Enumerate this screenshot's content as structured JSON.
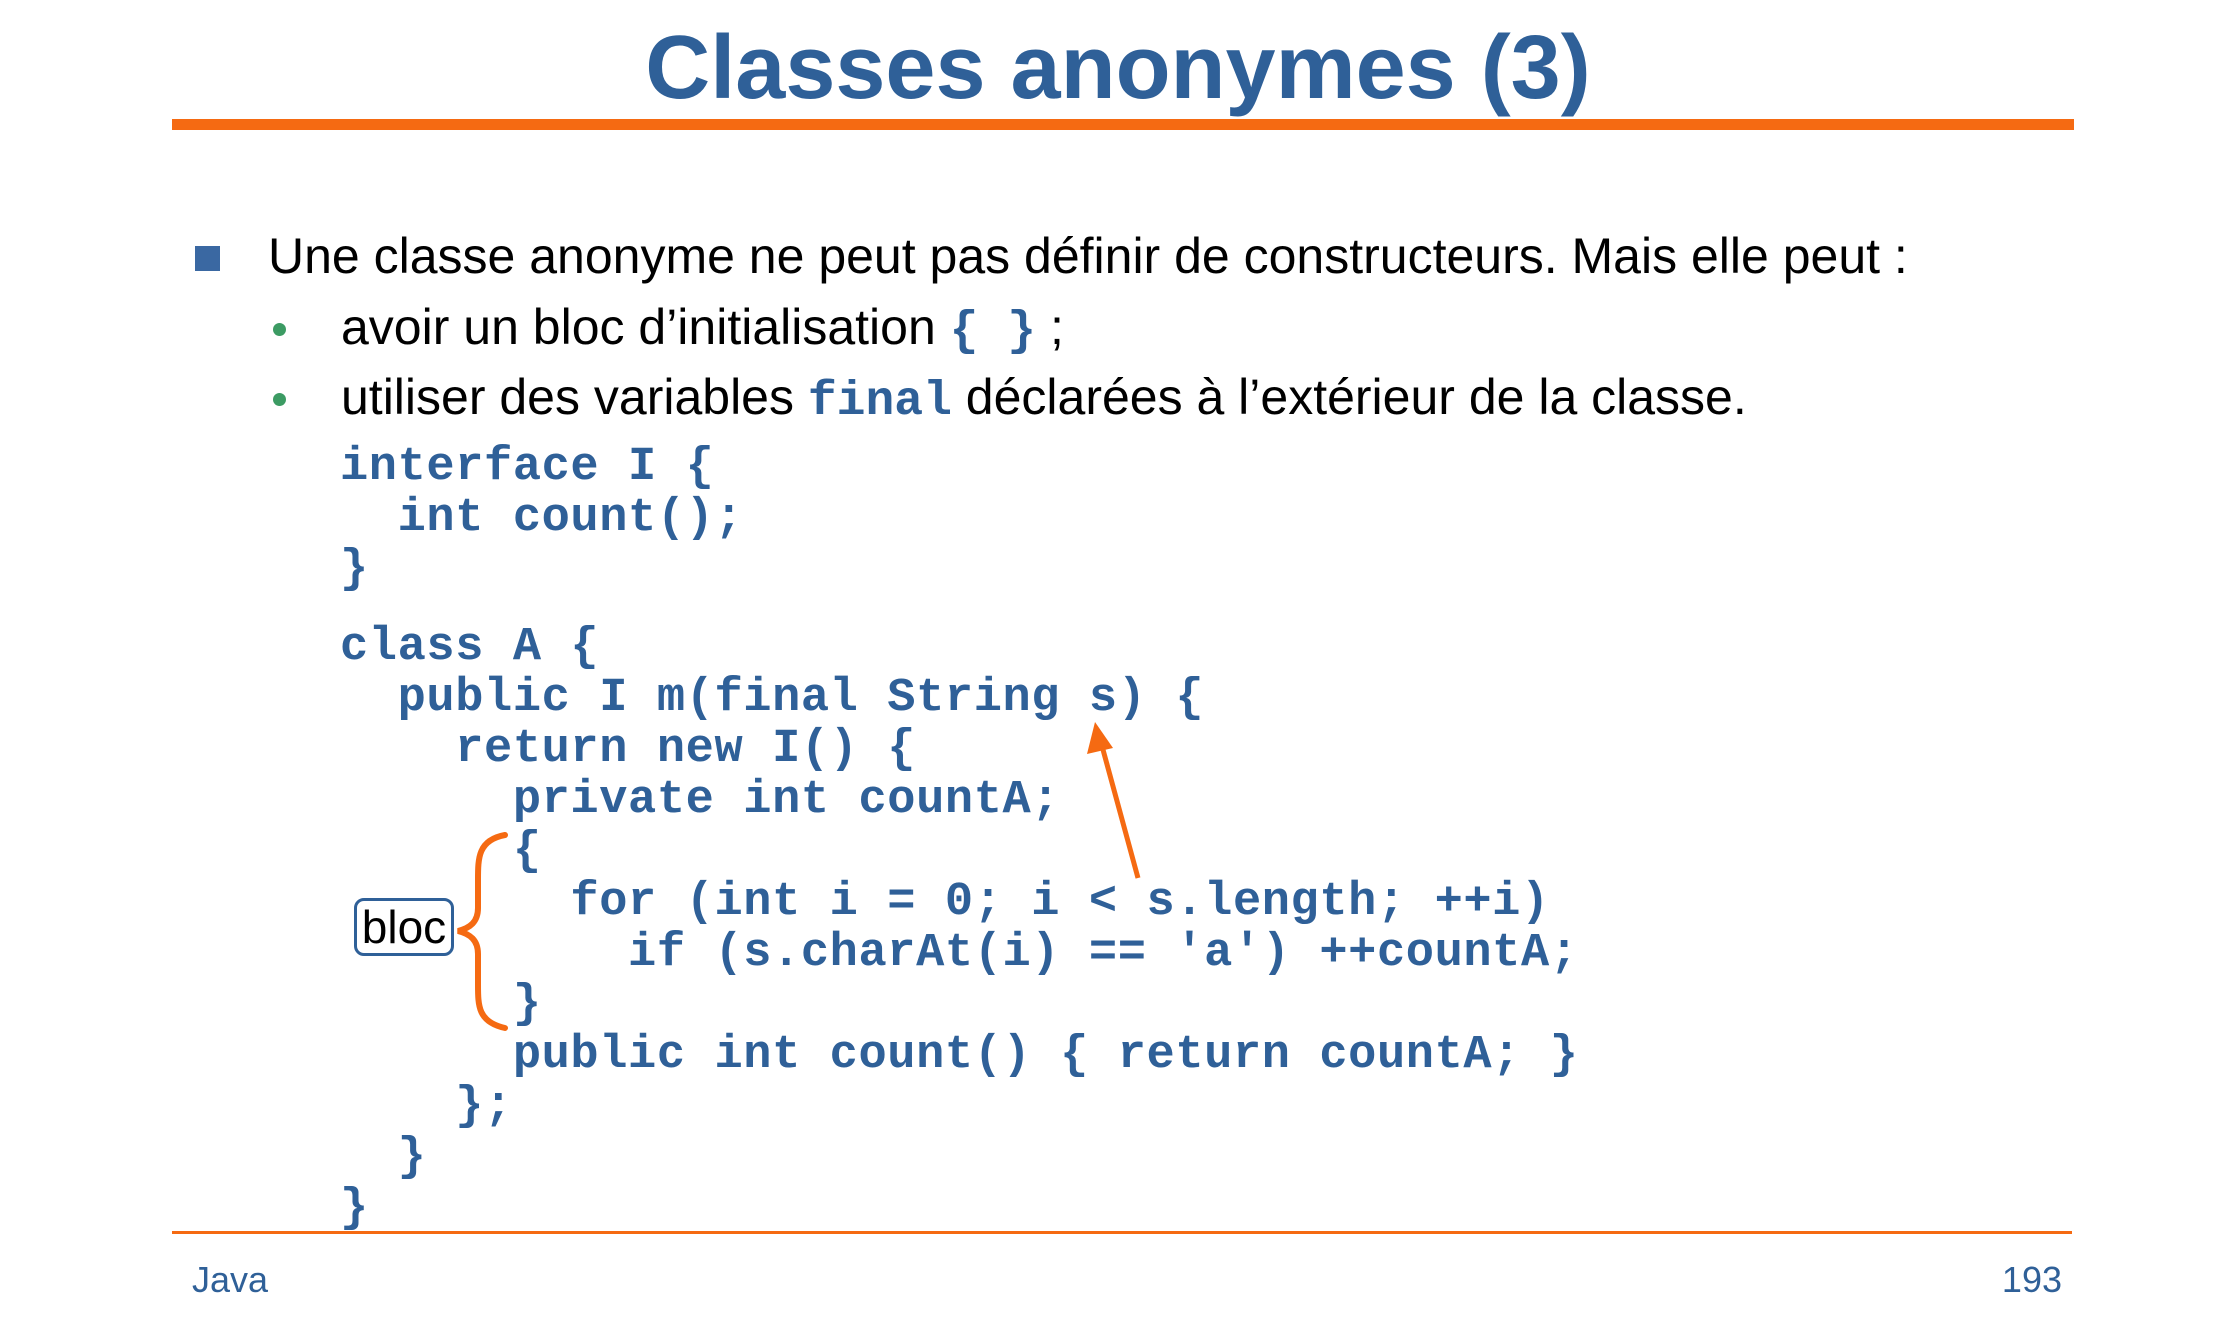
{
  "slide": {
    "title": "Classes anonymes (3)",
    "intro": "Une classe anonyme ne peut pas définir de constructeurs. Mais elle peut :",
    "bullets": [
      {
        "before": "avoir un bloc d’initialisation ",
        "code": "{ }",
        "after": " ;"
      },
      {
        "before": "utiliser des variables ",
        "code": "final",
        "after": " déclarées à l’extérieur de la classe."
      }
    ],
    "code_lines": [
      "interface I {",
      "  int count();",
      "}",
      "class A {",
      "  public I m(final String s) {",
      "    return new I() {",
      "      private int countA;",
      "      {",
      "        for (int i = 0; i < s.length; ++i)",
      "          if (s.charAt(i) == 'a') ++countA;",
      "      }",
      "      public int count() { return countA; }",
      "    };",
      "  }",
      "}"
    ],
    "annotation_label": "bloc",
    "footer_left": "Java",
    "footer_right": "193",
    "colors": {
      "title": "#2f6098",
      "accent": "#f56a12",
      "code": "#2f6098",
      "bullet_square": "#3a68a2",
      "bullet_dot": "#3c9b63"
    }
  }
}
